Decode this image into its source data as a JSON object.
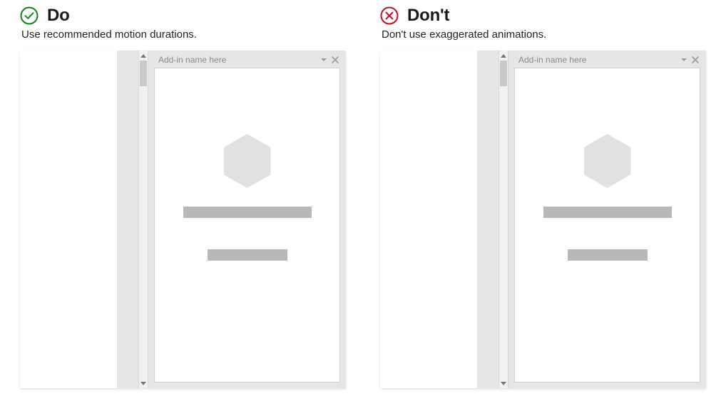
{
  "do": {
    "title": "Do",
    "subtitle": "Use recommended motion durations.",
    "icon_color": "#118511",
    "pane_title": "Add-in name here"
  },
  "dont": {
    "title": "Don't",
    "subtitle": "Don't use exaggerated animations.",
    "icon_color": "#c50f1f",
    "pane_title": "Add-in name here"
  }
}
